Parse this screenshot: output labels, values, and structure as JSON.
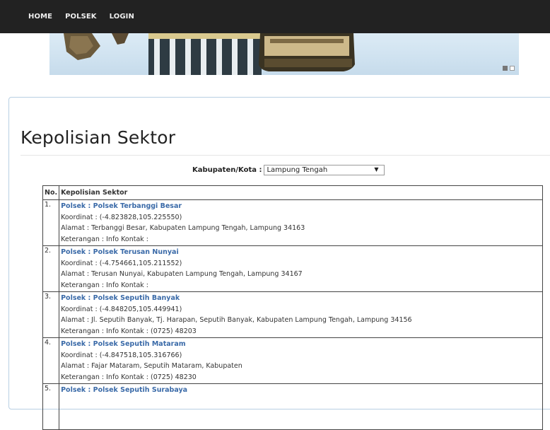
{
  "nav": {
    "items": [
      "HOME",
      "POLSEK",
      "LOGIN"
    ]
  },
  "page_title": "Kepolisian Sektor",
  "filter": {
    "label": "Kabupaten/Kota :",
    "selected": "Lampung Tengah"
  },
  "table": {
    "headers": [
      "No.",
      "Kepolisian Sektor"
    ],
    "rows": [
      {
        "no": "1.",
        "name": "Polsek : Polsek Terbanggi Besar",
        "koordinat": "Koordinat : (-4.823828,105.225550)",
        "alamat": "Alamat : Terbanggi Besar, Kabupaten Lampung Tengah, Lampung 34163",
        "keterangan": "Keterangan : Info Kontak :"
      },
      {
        "no": "2.",
        "name": "Polsek : Polsek Terusan Nunyai",
        "koordinat": "Koordinat : (-4.754661,105.211552)",
        "alamat": "Alamat : Terusan Nunyai, Kabupaten Lampung Tengah, Lampung 34167",
        "keterangan": "Keterangan : Info Kontak :"
      },
      {
        "no": "3.",
        "name": "Polsek : Polsek Seputih Banyak",
        "koordinat": "Koordinat : (-4.848205,105.449941)",
        "alamat": "Alamat : Jl. Seputih Banyak, Tj. Harapan, Seputih Banyak, Kabupaten Lampung Tengah, Lampung 34156",
        "keterangan": "Keterangan : Info Kontak : (0725) 48203"
      },
      {
        "no": "4.",
        "name": "Polsek : Polsek Seputih Mataram",
        "koordinat": "Koordinat : (-4.847518,105.316766)",
        "alamat": "Alamat : Fajar Mataram, Seputih Mataram, Kabupaten",
        "keterangan": "Keterangan : Info Kontak : (0725) 48230"
      },
      {
        "no": "5.",
        "name": "Polsek : Polsek Seputih Surabaya",
        "koordinat": "",
        "alamat": "",
        "keterangan": ""
      }
    ]
  }
}
